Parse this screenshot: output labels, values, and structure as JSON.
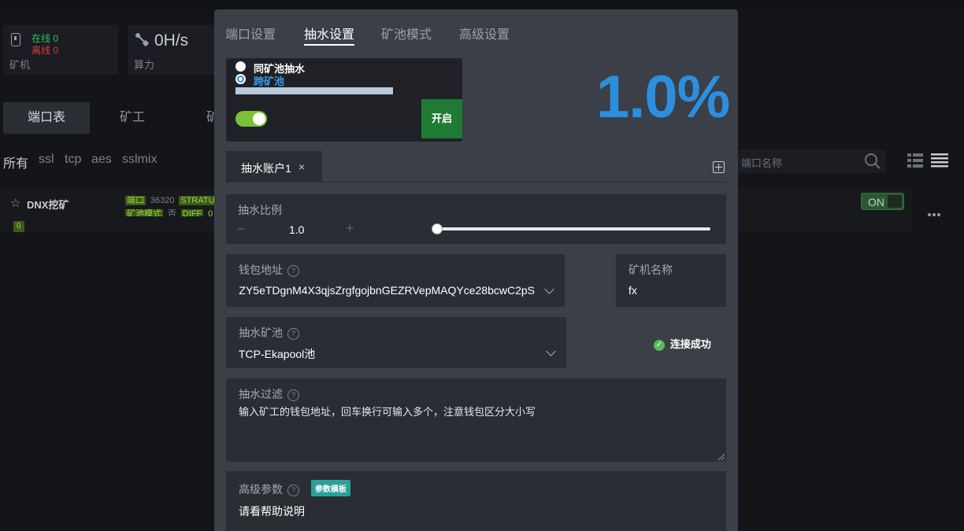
{
  "background": {
    "stats": {
      "miners": {
        "online_label": "在线 0",
        "offline_label": "离线 0",
        "label": "矿机"
      },
      "hashrate": {
        "value": "0H/s",
        "label": "算力"
      }
    },
    "tabs": [
      "端口表",
      "矿工",
      "矿"
    ],
    "filters": [
      "所有",
      "ssl",
      "tcp",
      "aes",
      "sslmix"
    ],
    "search_placeholder": "端口名称",
    "row": {
      "name": "DNX挖矿",
      "tags": {
        "port_label": "端口",
        "port_value": "36320",
        "strat": "STRATU",
        "pool_mode_label": "矿池模式",
        "pool_mode_value": "否",
        "diff": "DIFF",
        "diff_value": "0"
      },
      "count": "0",
      "toggle": "ON"
    }
  },
  "modal": {
    "tabs": [
      "端口设置",
      "抽水设置",
      "矿池模式",
      "高级设置"
    ],
    "active_tab": "抽水设置",
    "mode_options": [
      "同矿池抽水",
      "跨矿池"
    ],
    "selected_mode": "跨矿池",
    "enable_button": "开启",
    "percentage": "1.0%",
    "account_tab": {
      "label": "抽水账户1",
      "close": "×"
    },
    "ratio": {
      "label": "抽水比例",
      "minus": "−",
      "value": "1.0",
      "plus": "+"
    },
    "wallet": {
      "label": "钱包地址",
      "value": "iZY5eTDgnM4X3qjsZrgfgojbnGEZRVepMAQYce28bcwC2pS"
    },
    "miner_name": {
      "label": "矿机名称",
      "value": "fx"
    },
    "pool": {
      "label": "抽水矿池",
      "value": "TCP-Ekapool池"
    },
    "status": "连接成功",
    "filter": {
      "label": "抽水过滤",
      "value": "输入矿工的钱包地址，回车换行可输入多个，注意钱包区分大小写"
    },
    "advanced": {
      "label": "高级参数",
      "badge": "参数模板",
      "value": "请看帮助说明"
    },
    "help_glyph": "?"
  },
  "colors": {
    "accent_blue": "#2b8fde",
    "green": "#1f7a34",
    "toggle_green": "#7cc13a",
    "badge_teal": "#2aa198"
  }
}
